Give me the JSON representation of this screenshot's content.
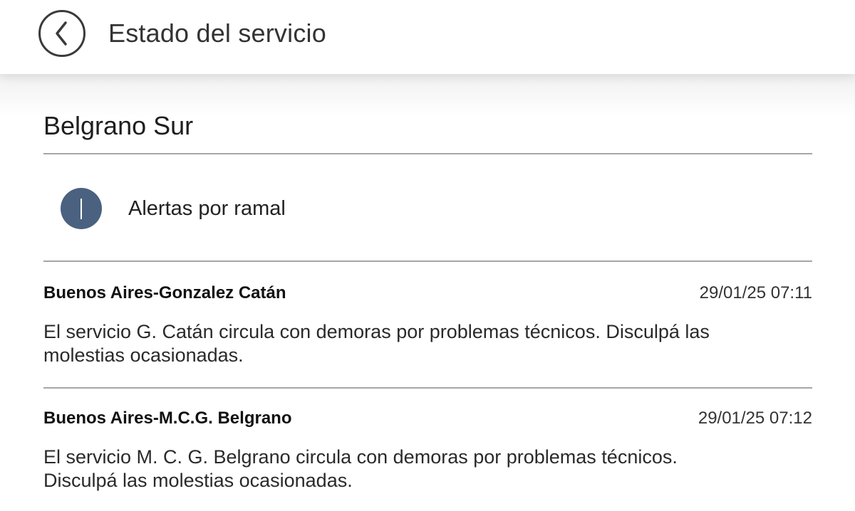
{
  "header": {
    "title": "Estado del servicio",
    "back_icon": "chevron-left-icon"
  },
  "line": {
    "name": "Belgrano Sur"
  },
  "alerts_section": {
    "icon": "info-icon",
    "label": "Alertas por ramal"
  },
  "alerts": [
    {
      "branch": "Buenos Aires-Gonzalez Catán",
      "timestamp": "29/01/25 07:11",
      "message": "El servicio G. Catán circula con demoras por problemas técnicos. Disculpá las molestias ocasionadas."
    },
    {
      "branch": "Buenos Aires-M.C.G. Belgrano",
      "timestamp": "29/01/25 07:12",
      "message": "El servicio M. C. G. Belgrano circula con demoras por problemas técnicos. Disculpá las molestias ocasionadas."
    }
  ],
  "colors": {
    "info_icon": "#4a6180",
    "divider": "#a6a6a6"
  }
}
